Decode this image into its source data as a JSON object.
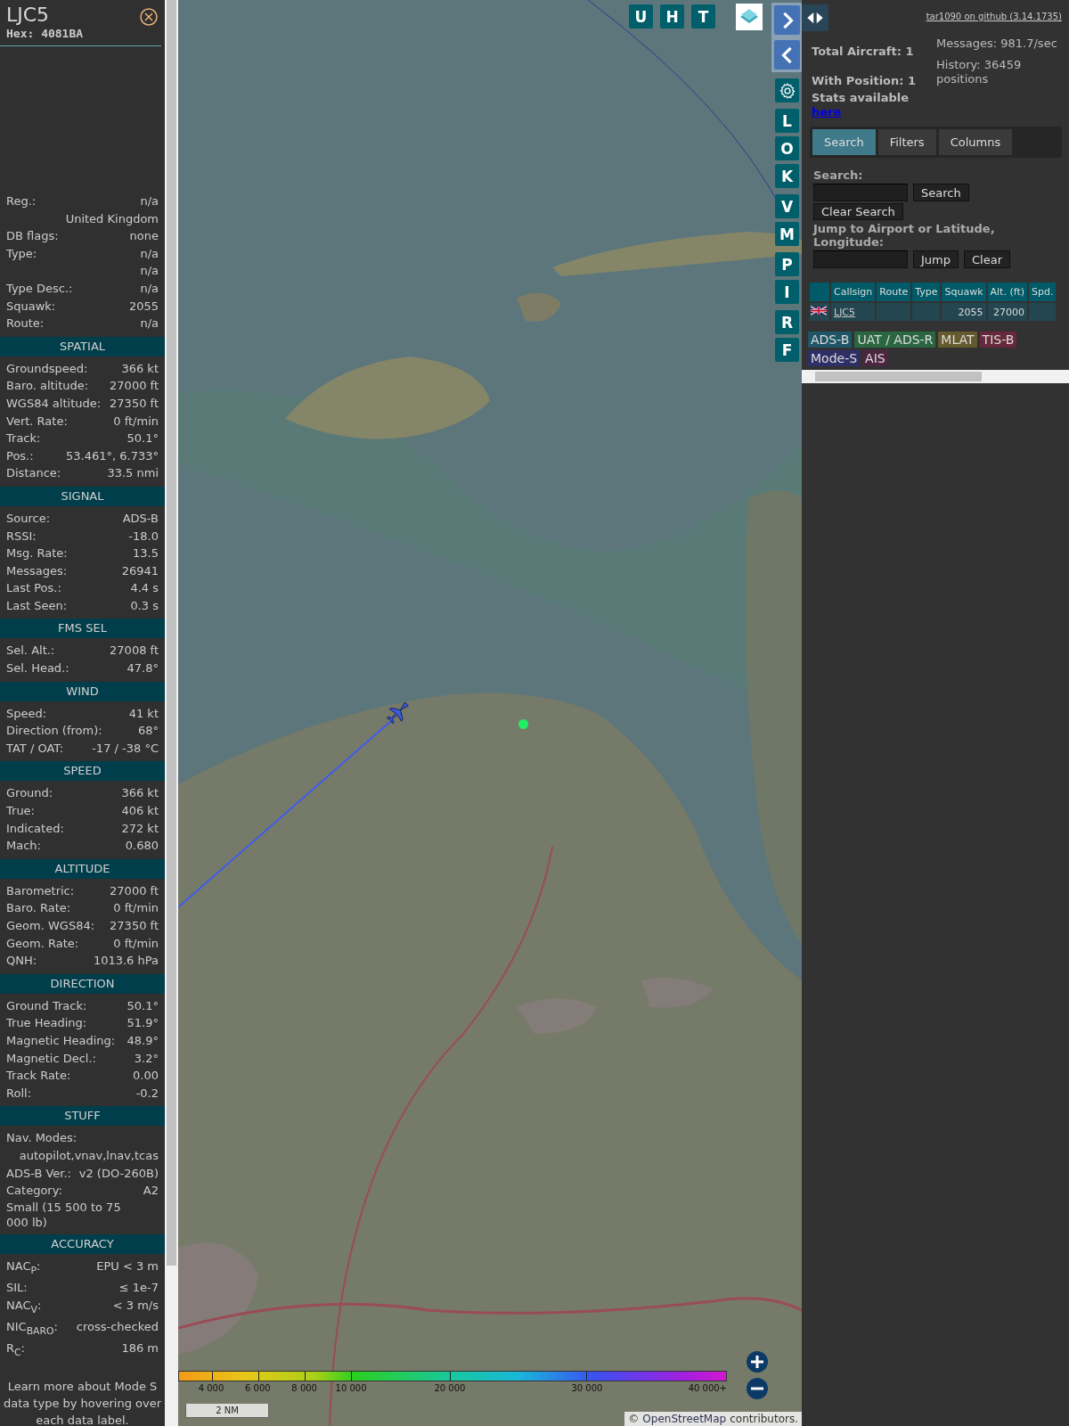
{
  "aircraft": {
    "callsign": "LJC5",
    "hex": "Hex: 4081BA"
  },
  "info_rows": [
    {
      "label": "Reg.:",
      "value": "n/a"
    },
    {
      "value": "United Kingdom"
    },
    {
      "label": "DB flags:",
      "value": "none"
    },
    {
      "label": "Type:",
      "value": "n/a"
    },
    {
      "value": "n/a"
    },
    {
      "label": "Type Desc.:",
      "value": "n/a"
    },
    {
      "label": "Squawk:",
      "value": "2055"
    },
    {
      "label": "Route:",
      "value": "n/a"
    }
  ],
  "sections": [
    {
      "title": "SPATIAL",
      "rows": [
        {
          "kind": "pair",
          "label": "Groundspeed:",
          "value": "366 kt"
        },
        {
          "kind": "pair",
          "label": "Baro. altitude:",
          "value": "27000 ft"
        },
        {
          "kind": "pair",
          "label": "WGS84 altitude:",
          "value": "27350 ft"
        },
        {
          "kind": "pair",
          "label": "Vert. Rate:",
          "value": "0 ft/min"
        },
        {
          "kind": "pair",
          "label": "Track:",
          "value": "50.1°"
        },
        {
          "kind": "pair",
          "label": "Pos.:",
          "value": "53.461°, 6.733°"
        },
        {
          "kind": "pair",
          "label": "Distance:",
          "value": "33.5 nmi"
        }
      ]
    },
    {
      "title": "SIGNAL",
      "rows": [
        {
          "kind": "pair",
          "label": "Source:",
          "value": "ADS-B"
        },
        {
          "kind": "pair",
          "label": "RSSI:",
          "value": "-18.0"
        },
        {
          "kind": "pair",
          "label": "Msg. Rate:",
          "value": "13.5"
        },
        {
          "kind": "pair",
          "label": "Messages:",
          "value": "26941"
        },
        {
          "kind": "pair",
          "label": "Last Pos.:",
          "value": "4.4 s"
        },
        {
          "kind": "pair",
          "label": "Last Seen:",
          "value": "0.3 s"
        }
      ]
    },
    {
      "title": "FMS SEL",
      "rows": [
        {
          "kind": "pair",
          "label": "Sel. Alt.:",
          "value": "27008 ft"
        },
        {
          "kind": "pair",
          "label": "Sel. Head.:",
          "value": "47.8°"
        }
      ]
    },
    {
      "title": "WIND",
      "rows": [
        {
          "kind": "pair",
          "label": "Speed:",
          "value": "41 kt"
        },
        {
          "kind": "pair",
          "label": "Direction (from):",
          "value": "68°"
        },
        {
          "kind": "pair",
          "label": "TAT / OAT:",
          "value": "-17 / -38 °C"
        }
      ]
    },
    {
      "title": "SPEED",
      "rows": [
        {
          "kind": "pair",
          "label": "Ground:",
          "value": "366 kt"
        },
        {
          "kind": "pair",
          "label": "True:",
          "value": "406 kt"
        },
        {
          "kind": "pair",
          "label": "Indicated:",
          "value": "272 kt"
        },
        {
          "kind": "pair",
          "label": "Mach:",
          "value": "0.680"
        }
      ]
    },
    {
      "title": "ALTITUDE",
      "rows": [
        {
          "kind": "pair",
          "label": "Barometric:",
          "value": "27000 ft"
        },
        {
          "kind": "pair",
          "label": "Baro. Rate:",
          "value": "0 ft/min"
        },
        {
          "kind": "pair",
          "label": "Geom. WGS84:",
          "value": "27350 ft"
        },
        {
          "kind": "pair",
          "label": "Geom. Rate:",
          "value": "0 ft/min"
        },
        {
          "kind": "pair",
          "label": "QNH:",
          "value": "1013.6 hPa"
        }
      ]
    },
    {
      "title": "DIRECTION",
      "rows": [
        {
          "kind": "pair",
          "label": "Ground Track:",
          "value": "50.1°"
        },
        {
          "kind": "pair",
          "label": "True Heading:",
          "value": "51.9°"
        },
        {
          "kind": "pair",
          "label": "Magnetic Heading:",
          "value": "48.9°"
        },
        {
          "kind": "pair",
          "label": "Magnetic Decl.:",
          "value": "3.2°"
        },
        {
          "kind": "pair",
          "label": "Track Rate:",
          "value": "0.00"
        },
        {
          "kind": "pair",
          "label": "Roll:",
          "value": "-0.2"
        }
      ]
    },
    {
      "title": "STUFF",
      "rows": [
        {
          "kind": "pair",
          "label": "Nav. Modes:"
        },
        {
          "kind": "pair",
          "value": "autopilot,vnav,lnav,tcas"
        },
        {
          "kind": "pair",
          "label": "ADS-B Ver.:",
          "value": "v2 (DO-260B)"
        },
        {
          "kind": "pair",
          "label": "Category:",
          "value": "A2"
        },
        {
          "kind": "note",
          "value": "Small (15 500 to 75 000 lb)"
        }
      ]
    },
    {
      "title": "ACCURACY",
      "rows": [
        {
          "kind": "pair",
          "label": "NAC$_{P}$:",
          "value": "EPU < 3 m"
        },
        {
          "kind": "pair",
          "label": "SIL:",
          "value": "≤ 1e-7"
        },
        {
          "kind": "pair",
          "label": "NAC$_{V}$:",
          "value": "< 3 m/s"
        },
        {
          "kind": "pair",
          "label": "NIC$_{BARO}$:",
          "value": "cross-checked"
        },
        {
          "kind": "pair",
          "label": "R$_{C}$:",
          "value": "186 m"
        }
      ]
    }
  ],
  "footer_note": "Learn more about Mode S data type by hovering over each data label.",
  "map": {
    "top_buttons": [
      {
        "label": "U"
      },
      {
        "label": "H"
      },
      {
        "label": "T"
      }
    ],
    "side_groups": [
      [
        {
          "kind": "chevron_right"
        },
        {
          "kind": "chevron_left"
        }
      ],
      [
        {
          "kind": "gear"
        }
      ],
      [
        {
          "kind": "letter",
          "label": "L"
        },
        {
          "kind": "letter",
          "label": "O"
        },
        {
          "kind": "letter",
          "label": "K"
        }
      ],
      [
        {
          "kind": "letter",
          "label": "V"
        },
        {
          "kind": "letter",
          "label": "M"
        }
      ],
      [
        {
          "kind": "letter",
          "label": "P"
        },
        {
          "kind": "letter",
          "label": "I"
        }
      ],
      [
        {
          "kind": "letter",
          "label": "R"
        },
        {
          "kind": "letter",
          "label": "F"
        }
      ]
    ],
    "altitude_legend": [
      "4 000",
      "6 000",
      "8 000",
      "10 000",
      "20 000",
      "30 000",
      "40 000+"
    ],
    "scale": "2 NM",
    "attribution": {
      "prefix": "©",
      "link": "OpenStreetMap",
      "suffix": "contributors."
    }
  },
  "right": {
    "github_link": "tar1090 on github (3.14.1735)",
    "stats": {
      "total": "Total Aircraft: 1",
      "with_position": "With Position: 1",
      "messages": "Messages: 981.7/sec",
      "history": "History: 36459 positions",
      "stats_text": "Stats available",
      "stats_link": "here"
    },
    "tabs": [
      {
        "label": "Search",
        "selected": true
      },
      {
        "label": "Filters",
        "selected": false
      },
      {
        "label": "Columns",
        "selected": false
      }
    ],
    "search": {
      "label": "Search:",
      "button": "Search",
      "clear_button": "Clear Search",
      "jump_label": "Jump to Airport or Latitude, Longitude:",
      "jump_button": "Jump",
      "clear_jump_button": "Clear"
    },
    "table": {
      "columns": [
        "Callsign",
        "Route",
        "Type",
        "Squawk",
        "Alt. (ft)",
        "Spd."
      ],
      "rows": [
        {
          "cells": [
            "LJC5",
            "",
            "",
            "2055",
            "27000",
            ""
          ]
        }
      ]
    },
    "sources": [
      {
        "label": "ADS-B",
        "color": "#1f5566"
      },
      {
        "label": "UAT / ADS-R",
        "color": "#2a6640"
      },
      {
        "label": "MLAT",
        "color": "#645a2e"
      },
      {
        "label": "TIS-B",
        "color": "#66283a"
      },
      {
        "label": "Mode-S",
        "color": "#2e2f66"
      },
      {
        "label": "AIS",
        "color": "#4c2640"
      }
    ]
  }
}
